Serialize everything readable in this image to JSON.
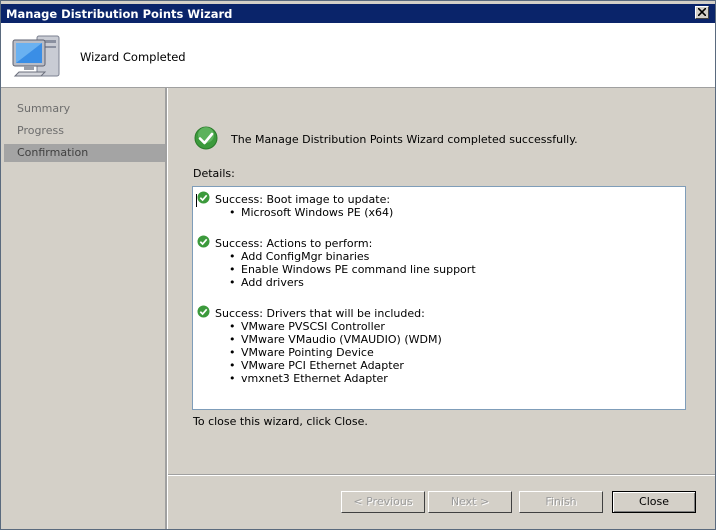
{
  "window": {
    "title": "Manage Distribution Points Wizard"
  },
  "header": {
    "title": "Wizard Completed",
    "icon": "computer-icon"
  },
  "sidebar": {
    "items": [
      {
        "label": "Summary",
        "active": false
      },
      {
        "label": "Progress",
        "active": false
      },
      {
        "label": "Confirmation",
        "active": true
      }
    ]
  },
  "main": {
    "success_message": "The Manage Distribution Points Wizard completed successfully.",
    "details_label": "Details:",
    "sections": [
      {
        "heading": "Success: Boot image to update:",
        "items": [
          "Microsoft Windows PE (x64)"
        ]
      },
      {
        "heading": "Success: Actions to perform:",
        "items": [
          "Add ConfigMgr binaries",
          "Enable Windows PE command line support",
          "Add drivers"
        ]
      },
      {
        "heading": "Success: Drivers that will be included:",
        "items": [
          "VMware PVSCSI Controller",
          "VMware VMaudio (VMAUDIO) (WDM)",
          "VMware Pointing Device",
          "VMware PCI Ethernet Adapter",
          "vmxnet3 Ethernet Adapter"
        ]
      }
    ],
    "close_hint": "To close this wizard, click Close."
  },
  "buttons": {
    "previous": "< Previous",
    "next": "Next >",
    "finish": "Finish",
    "close": "Close"
  },
  "colors": {
    "title_bar": "#0a246a",
    "success_green": "#3c9a3c",
    "active_nav": "#a4a4a4"
  }
}
